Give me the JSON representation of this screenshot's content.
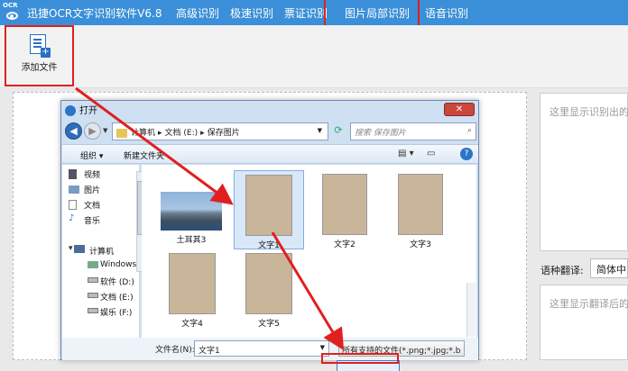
{
  "app": {
    "logo_text": "OCR",
    "title": "迅捷OCR文字识别软件V6.8"
  },
  "tabs": [
    {
      "label": "高级识别"
    },
    {
      "label": "极速识别"
    },
    {
      "label": "票证识别"
    },
    {
      "label": "图片局部识别"
    },
    {
      "label": "语音识别"
    }
  ],
  "toolbar": {
    "add_file_label": "添加文件"
  },
  "right": {
    "result_placeholder": "这里显示识别出的",
    "translate_label": "语种翻译:",
    "lang_selected": "简体中",
    "translate_placeholder": "这里显示翻译后的"
  },
  "dialog": {
    "title": "打开",
    "close": "✕",
    "breadcrumb": [
      "计算机",
      "▸",
      "文档 (E:)",
      "▸",
      "保存图片"
    ],
    "search_placeholder": "搜索 保存图片",
    "organize": "组织 ▾",
    "new_folder": "新建文件夹",
    "help": "?",
    "nav_items": [
      "视频",
      "图片",
      "文档",
      "音乐",
      "计算机",
      "Windows",
      "软件 (D:)",
      "文档 (E:)",
      "娱乐 (F:)"
    ],
    "files": [
      "土耳其3",
      "文字1",
      "文字2",
      "文字3",
      "文字4",
      "文字5"
    ],
    "filename_label": "文件名(N):",
    "filename_value": "文字1",
    "filetype_value": "所有支持的文件(*.png;*.jpg;*.b"
  },
  "colors": {
    "brand": "#3a8fd8",
    "highlight": "#e02020"
  }
}
